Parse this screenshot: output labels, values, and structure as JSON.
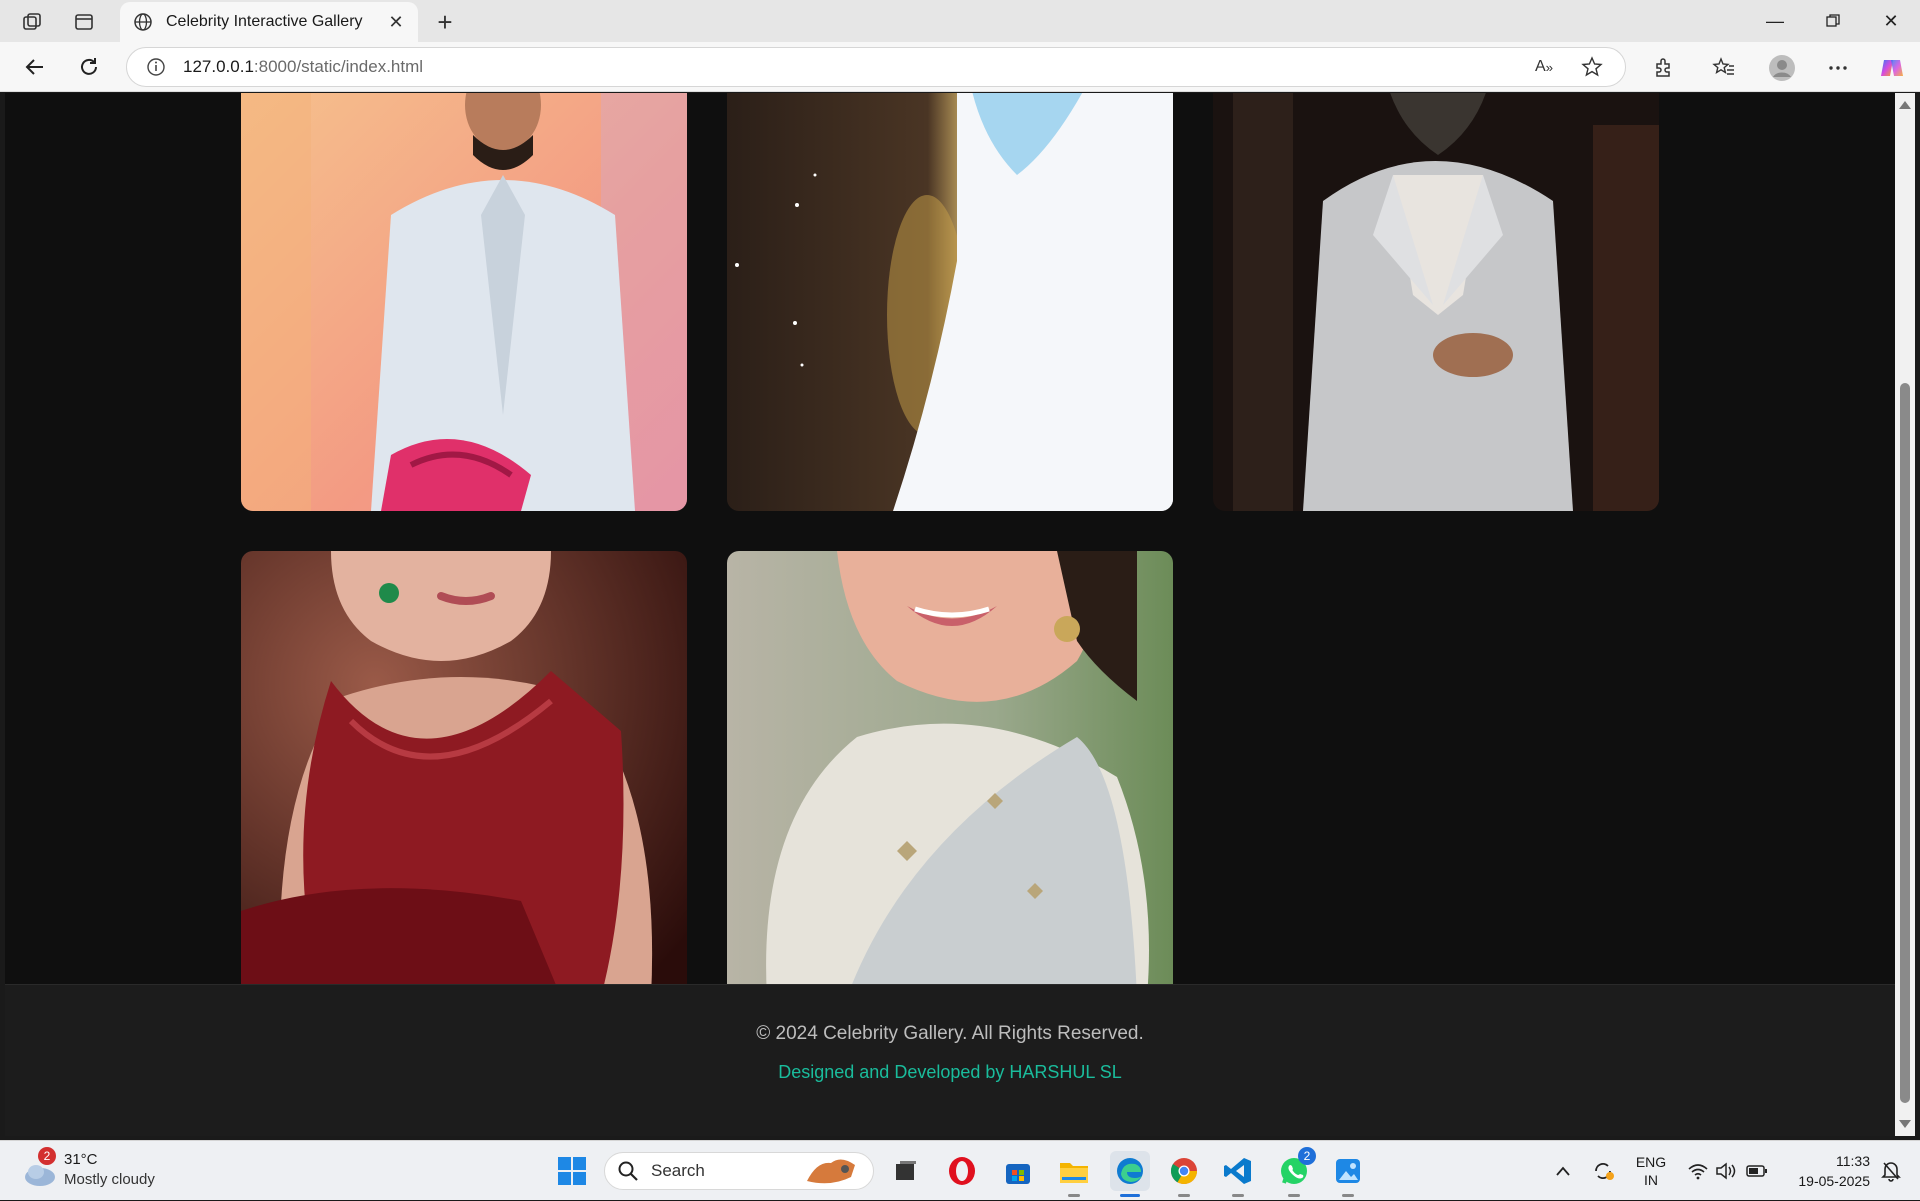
{
  "browser": {
    "tab_title": "Celebrity Interactive Gallery",
    "url_host": "127.0.0.1",
    "url_path": ":8000/static/index.html"
  },
  "gallery": {
    "cards": [
      {
        "subject": "man in light linen shirt holding pink cloth",
        "colors": [
          "#f2a07a",
          "#dfe6ee",
          "#e0306a"
        ]
      },
      {
        "subject": "person in white shirt, blurred bokeh background",
        "colors": [
          "#2b1f18",
          "#f5f7fa",
          "#a6d6f0"
        ]
      },
      {
        "subject": "bearded man in light grey suit",
        "colors": [
          "#1a1210",
          "#c8c8c8",
          "#e8e4df"
        ]
      },
      {
        "subject": "woman in maroon embroidered saree",
        "colors": [
          "#4a1410",
          "#8e1a22",
          "#d9a490"
        ]
      },
      {
        "subject": "smiling woman in pale embroidered saree",
        "colors": [
          "#9aa88c",
          "#e8e4dc",
          "#e8b09a"
        ]
      }
    ]
  },
  "footer": {
    "copyright": "© 2024 Celebrity Gallery. All Rights Reserved.",
    "credit": "Designed and Developed by HARSHUL SL"
  },
  "taskbar": {
    "weather_temp": "31°C",
    "weather_condition": "Mostly cloudy",
    "weather_badge": "2",
    "search_label": "Search",
    "whatsapp_badge": "2",
    "lang_top": "ENG",
    "lang_bottom": "IN",
    "time": "11:33",
    "date": "19-05-2025"
  },
  "colors": {
    "page_bg": "#0f0f0f",
    "footer_bg": "#1c1c1c",
    "credit_accent": "#1abc9c"
  }
}
